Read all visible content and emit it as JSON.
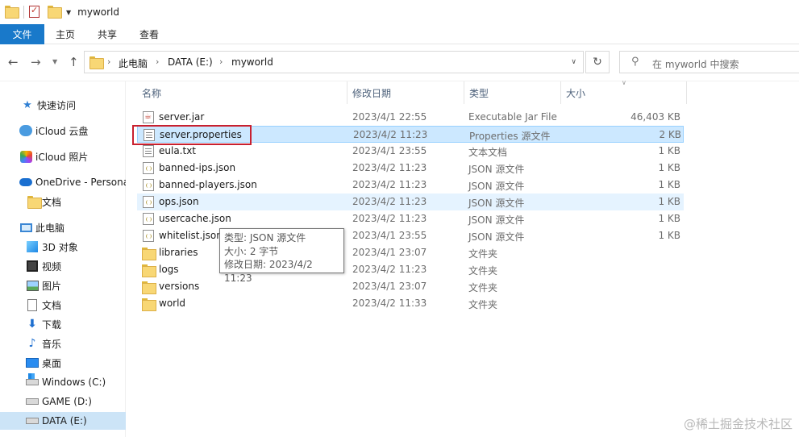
{
  "window": {
    "title": "myworld"
  },
  "ribbon": {
    "tabs": [
      "文件",
      "主页",
      "共享",
      "查看"
    ]
  },
  "address": {
    "crumbs": [
      "此电脑",
      "DATA (E:)",
      "myworld"
    ],
    "search_placeholder": "在 myworld 中搜索"
  },
  "sidebar": {
    "items": [
      {
        "label": "快速访问",
        "icon": "star-icon"
      },
      {
        "label": "iCloud 云盘",
        "icon": "cloud-icon"
      },
      {
        "label": "iCloud 照片",
        "icon": "photos-icon"
      },
      {
        "label": "OneDrive - Persona",
        "icon": "onedrive-icon"
      },
      {
        "label": "文档",
        "icon": "folder-icon"
      },
      {
        "label": "此电脑",
        "icon": "computer-icon"
      },
      {
        "label": "3D 对象",
        "icon": "cube-icon"
      },
      {
        "label": "视频",
        "icon": "video-icon"
      },
      {
        "label": "图片",
        "icon": "picture-icon"
      },
      {
        "label": "文档",
        "icon": "document-icon"
      },
      {
        "label": "下载",
        "icon": "download-icon"
      },
      {
        "label": "音乐",
        "icon": "music-icon"
      },
      {
        "label": "桌面",
        "icon": "desktop-icon"
      },
      {
        "label": "Windows (C:)",
        "icon": "windows-drive-icon"
      },
      {
        "label": "GAME (D:)",
        "icon": "drive-icon"
      },
      {
        "label": "DATA (E:)",
        "icon": "drive-icon",
        "selected": true
      }
    ]
  },
  "columns": {
    "name": "名称",
    "date": "修改日期",
    "type": "类型",
    "size": "大小"
  },
  "files": [
    {
      "name": "server.jar",
      "date": "2023/4/1 22:55",
      "type": "Executable Jar File",
      "size": "46,403 KB",
      "icon": "jar-file-icon"
    },
    {
      "name": "server.properties",
      "date": "2023/4/2 11:23",
      "type": "Properties 源文件",
      "size": "2 KB",
      "icon": "text-file-icon",
      "selected": true
    },
    {
      "name": "eula.txt",
      "date": "2023/4/1 23:55",
      "type": "文本文档",
      "size": "1 KB",
      "icon": "text-file-icon"
    },
    {
      "name": "banned-ips.json",
      "date": "2023/4/2 11:23",
      "type": "JSON 源文件",
      "size": "1 KB",
      "icon": "json-file-icon"
    },
    {
      "name": "banned-players.json",
      "date": "2023/4/2 11:23",
      "type": "JSON 源文件",
      "size": "1 KB",
      "icon": "json-file-icon"
    },
    {
      "name": "ops.json",
      "date": "2023/4/2 11:23",
      "type": "JSON 源文件",
      "size": "1 KB",
      "icon": "json-file-icon",
      "hover": true
    },
    {
      "name": "usercache.json",
      "date": "2023/4/2 11:23",
      "type": "JSON 源文件",
      "size": "1 KB",
      "icon": "json-file-icon"
    },
    {
      "name": "whitelist.json",
      "date": "2023/4/1 23:55",
      "type": "JSON 源文件",
      "size": "1 KB",
      "icon": "json-file-icon"
    },
    {
      "name": "libraries",
      "date": "2023/4/1 23:07",
      "type": "文件夹",
      "size": "",
      "icon": "folder-icon"
    },
    {
      "name": "logs",
      "date": "2023/4/2 11:23",
      "type": "文件夹",
      "size": "",
      "icon": "folder-icon"
    },
    {
      "name": "versions",
      "date": "2023/4/1 23:07",
      "type": "文件夹",
      "size": "",
      "icon": "folder-icon"
    },
    {
      "name": "world",
      "date": "2023/4/2 11:33",
      "type": "文件夹",
      "size": "",
      "icon": "folder-icon"
    }
  ],
  "tooltip": {
    "line1": "类型: JSON 源文件",
    "line2": "大小: 2 字节",
    "line3": "修改日期: 2023/4/2 11:23"
  },
  "watermark": "@稀土掘金技术社区",
  "colors": {
    "accent": "#1979ca",
    "selection": "#cce8ff",
    "highlight_box": "#c8202f"
  }
}
